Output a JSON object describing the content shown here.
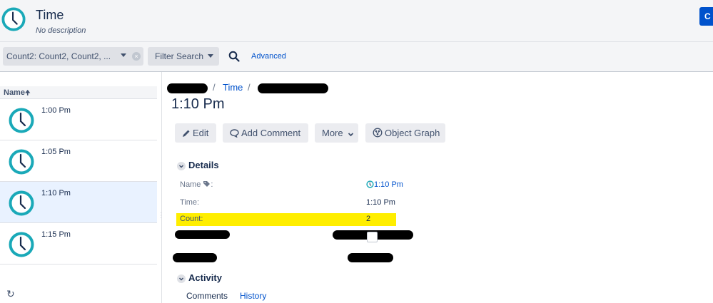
{
  "header": {
    "title": "Time",
    "description": "No description",
    "create_label": "C"
  },
  "filterbar": {
    "count_filter": "Count2: Count2, Count2, ...",
    "filter_search": "Filter Search",
    "advanced": "Advanced"
  },
  "list": {
    "column_header": "Name",
    "items": [
      {
        "label": "1:00 Pm"
      },
      {
        "label": "1:05 Pm"
      },
      {
        "label": "1:10 Pm"
      },
      {
        "label": "1:15 Pm"
      }
    ]
  },
  "detail": {
    "breadcrumb_sep": "/",
    "breadcrumb_time": "Time",
    "title": "1:10 Pm",
    "buttons": {
      "edit": "Edit",
      "add_comment": "Add Comment",
      "more": "More",
      "object_graph": "Object Graph"
    },
    "details_heading": "Details",
    "attributes": {
      "name_label": "Name",
      "name_value": "1:10 Pm",
      "time_label": "Time:",
      "time_value": "1:10 Pm",
      "count_label": "Count:",
      "count_value": "2"
    },
    "activity_heading": "Activity",
    "tabs": {
      "comments": "Comments",
      "history": "History"
    }
  },
  "colors": {
    "accent": "#0052cc",
    "clock_ring": "#1aa9b8",
    "highlight": "#ffee00",
    "selected_row": "#e9f2ff"
  }
}
